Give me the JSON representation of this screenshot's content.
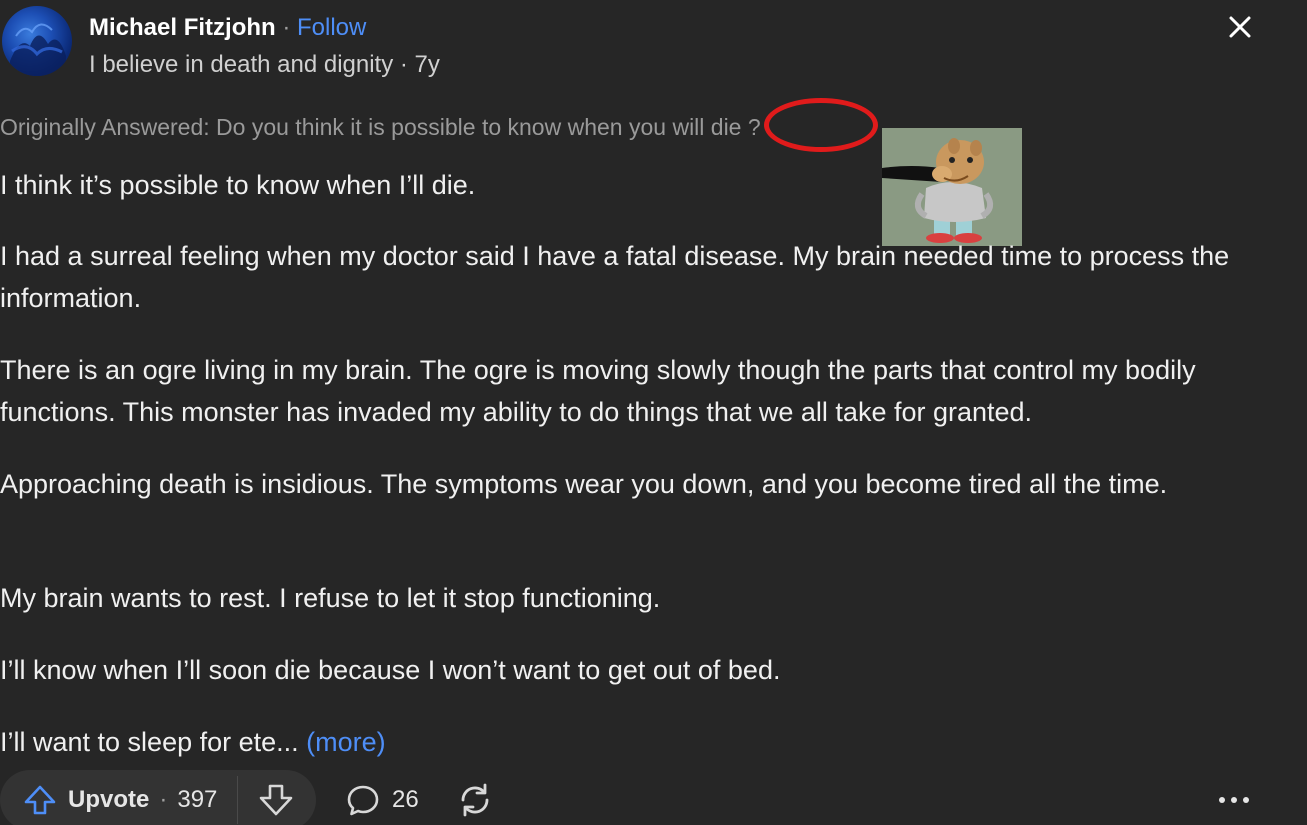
{
  "header": {
    "author_name": "Michael Fitzjohn",
    "separator": " · ",
    "follow_label": "Follow",
    "tagline": "I believe in death and dignity · 7y"
  },
  "question": {
    "prefix": "Originally Answered: Do you think it is possible to know when you ",
    "highlight": "will die",
    "suffix": " ?"
  },
  "paragraphs": [
    "I think it’s possible to know when I’ll die.",
    "I had a surreal feeling when my doctor said I have a fatal disease. My brain needed time to process the information.",
    "There is an ogre living in my brain. The ogre is moving slowly though the parts that control my bodily functions. This monster has invaded my ability to do things that we all take for granted.",
    "Approaching death is insidious. The symptoms wear you down, and you become tired all the time.",
    "My brain wants to rest. I refuse to let it stop functioning.",
    "I’ll know when I’ll soon die because I won’t want to get out of bed."
  ],
  "truncated": {
    "text": "I’ll want to sleep for ete...",
    "more_label": "(more)"
  },
  "actions": {
    "upvote_label": "Upvote",
    "upvote_separator": "·",
    "upvote_count": "397",
    "comment_count": "26"
  },
  "icons": {
    "close": "close-icon",
    "upvote": "arrow-up-icon",
    "downvote": "arrow-down-icon",
    "comment": "comment-bubble-icon",
    "share": "reshare-icon",
    "more": "more-dots-icon"
  },
  "colors": {
    "background": "#262626",
    "link": "#4e8ef7",
    "annotation": "#e01b1b",
    "upvote_icon": "#4e8ef7"
  }
}
